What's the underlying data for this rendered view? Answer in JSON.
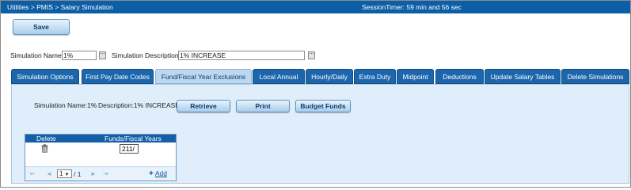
{
  "header": {
    "breadcrumb": [
      "Utilities",
      "PMIS",
      "Salary Simulation"
    ],
    "separator": ">",
    "session_timer": "SessionTimer: 59 min and 56 sec"
  },
  "toolbar": {
    "save_label": "Save"
  },
  "form": {
    "simulation_name_label": "Simulation Name:",
    "simulation_name_value": "1%",
    "simulation_description_label": "Simulation Description:",
    "simulation_description_value": "1% INCREASE",
    "lookup_glyph": "⋯"
  },
  "tabs": [
    {
      "label": "Simulation Options"
    },
    {
      "label": "First Pay Date Codes"
    },
    {
      "label": "Fund/Fiscal Year Exclusions",
      "active": true
    },
    {
      "label": "Local Annual"
    },
    {
      "label": "Hourly/Daily"
    },
    {
      "label": "Extra Duty"
    },
    {
      "label": "Midpoint"
    },
    {
      "label": "Deductions"
    },
    {
      "label": "Update Salary Tables"
    },
    {
      "label": "Delete Simulations"
    }
  ],
  "panel": {
    "name_text": "Simulation Name:1%",
    "description_text": "Description:1% INCREASE",
    "buttons": {
      "retrieve": "Retrieve",
      "print": "Print",
      "budget_funds": "Budget Funds"
    }
  },
  "grid": {
    "columns": [
      "Delete",
      "Funds/Fiscal Years"
    ],
    "rows": [
      {
        "delete_icon": "trash-icon",
        "funds_fiscal_years": "211/"
      }
    ],
    "pager": {
      "first_glyph": "⇤",
      "prev_glyph": "◄",
      "next_glyph": "►",
      "last_glyph": "⇥",
      "current_page": "1",
      "page_total": "/ 1",
      "add_label": "Add",
      "add_glyph": "+"
    }
  },
  "colors": {
    "title_bar": "#0c5ea6",
    "tab": "#1d66ac",
    "tab_active": "#bcd7ef",
    "panel": "#dfeefa",
    "grid_header": "#145fa8"
  }
}
